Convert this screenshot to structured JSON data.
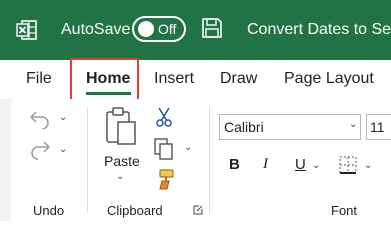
{
  "titlebar": {
    "app_icon": "excel-logo-icon",
    "autosave_label": "AutoSave",
    "autosave_state": "Off",
    "save_icon": "save-icon",
    "document_title": "Convert Dates to Seria"
  },
  "tabs": [
    {
      "label": "File"
    },
    {
      "label": "Home",
      "active": true
    },
    {
      "label": "Insert"
    },
    {
      "label": "Draw"
    },
    {
      "label": "Page Layout"
    }
  ],
  "ribbon": {
    "undo_group": {
      "label": "Undo",
      "icons": [
        "undo-icon",
        "redo-icon"
      ]
    },
    "clipboard_group": {
      "label": "Clipboard",
      "paste_label": "Paste",
      "icons": [
        "paste-icon",
        "cut-icon",
        "copy-icon",
        "format-painter-icon",
        "dialog-launcher-icon"
      ]
    },
    "font_group": {
      "label": "Font",
      "font_name": "Calibri",
      "font_size": "11",
      "bold": "B",
      "italic": "I",
      "underline": "U",
      "icons": [
        "borders-icon"
      ]
    }
  },
  "colors": {
    "titlebar_bg": "#217346",
    "tab_underline": "#217346",
    "highlight": "#e63c3c",
    "ribbon_bg": "#f3f3f3"
  }
}
